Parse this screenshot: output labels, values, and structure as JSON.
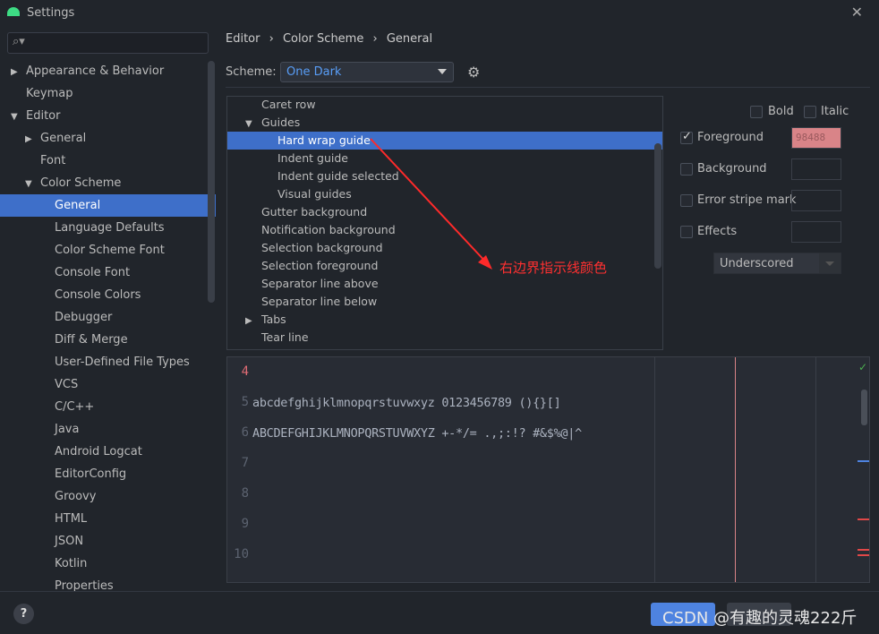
{
  "window": {
    "title": "Settings",
    "close": "✕"
  },
  "sidebar": {
    "search_icon": "⌕▾",
    "items": [
      {
        "label": "Appearance & Behavior",
        "arrow": "▶",
        "indent": 0
      },
      {
        "label": "Keymap",
        "arrow": "",
        "indent": 0
      },
      {
        "label": "Editor",
        "arrow": "▼",
        "indent": 0
      },
      {
        "label": "General",
        "arrow": "▶",
        "indent": 1
      },
      {
        "label": "Font",
        "arrow": "",
        "indent": 1
      },
      {
        "label": "Color Scheme",
        "arrow": "▼",
        "indent": 1
      },
      {
        "label": "General",
        "arrow": "",
        "indent": 2,
        "selected": true
      },
      {
        "label": "Language Defaults",
        "arrow": "",
        "indent": 2
      },
      {
        "label": "Color Scheme Font",
        "arrow": "",
        "indent": 2
      },
      {
        "label": "Console Font",
        "arrow": "",
        "indent": 2
      },
      {
        "label": "Console Colors",
        "arrow": "",
        "indent": 2
      },
      {
        "label": "Debugger",
        "arrow": "",
        "indent": 2
      },
      {
        "label": "Diff & Merge",
        "arrow": "",
        "indent": 2
      },
      {
        "label": "User-Defined File Types",
        "arrow": "",
        "indent": 2
      },
      {
        "label": "VCS",
        "arrow": "",
        "indent": 2
      },
      {
        "label": "C/C++",
        "arrow": "",
        "indent": 2
      },
      {
        "label": "Java",
        "arrow": "",
        "indent": 2
      },
      {
        "label": "Android Logcat",
        "arrow": "",
        "indent": 2
      },
      {
        "label": "EditorConfig",
        "arrow": "",
        "indent": 2
      },
      {
        "label": "Groovy",
        "arrow": "",
        "indent": 2
      },
      {
        "label": "HTML",
        "arrow": "",
        "indent": 2
      },
      {
        "label": "JSON",
        "arrow": "",
        "indent": 2
      },
      {
        "label": "Kotlin",
        "arrow": "",
        "indent": 2
      },
      {
        "label": "Properties",
        "arrow": "",
        "indent": 2
      }
    ]
  },
  "breadcrumb": [
    "Editor",
    "›",
    "Color Scheme",
    "›",
    "General"
  ],
  "scheme": {
    "label": "Scheme:",
    "value": "One Dark"
  },
  "tree": [
    {
      "label": "Caret row",
      "arrow": "",
      "indent": 1
    },
    {
      "label": "Guides",
      "arrow": "▼",
      "indent": 1
    },
    {
      "label": "Hard wrap guide",
      "arrow": "",
      "indent": 2,
      "selected": true
    },
    {
      "label": "Indent guide",
      "arrow": "",
      "indent": 2
    },
    {
      "label": "Indent guide selected",
      "arrow": "",
      "indent": 2
    },
    {
      "label": "Visual guides",
      "arrow": "",
      "indent": 2
    },
    {
      "label": "Gutter background",
      "arrow": "",
      "indent": 1
    },
    {
      "label": "Notification background",
      "arrow": "",
      "indent": 1
    },
    {
      "label": "Selection background",
      "arrow": "",
      "indent": 1
    },
    {
      "label": "Selection foreground",
      "arrow": "",
      "indent": 1
    },
    {
      "label": "Separator line above",
      "arrow": "",
      "indent": 1
    },
    {
      "label": "Separator line below",
      "arrow": "",
      "indent": 1
    },
    {
      "label": "Tabs",
      "arrow": "▶",
      "indent": 1
    },
    {
      "label": "Tear line",
      "arrow": "",
      "indent": 1
    }
  ],
  "props": {
    "bold": "Bold",
    "italic": "Italic",
    "foreground": "Foreground",
    "foreground_checked": true,
    "foreground_value": "98488",
    "foreground_color": "#d98488",
    "background": "Background",
    "error_stripe": "Error stripe mark",
    "effects": "Effects",
    "effect_type": "Underscored"
  },
  "editor": {
    "lines": [
      {
        "n": "4",
        "text": ""
      },
      {
        "n": "5",
        "text": "abcdefghijklmnopqrstuvwxyz 0123456789 (){}[]"
      },
      {
        "n": "6",
        "text": "ABCDEFGHIJKLMNOPQRSTUVWXYZ +-*/= .,;:!? #&$%@|^"
      },
      {
        "n": "7",
        "text": ""
      },
      {
        "n": "8",
        "text": ""
      },
      {
        "n": "9",
        "text": ""
      },
      {
        "n": "10",
        "text": ""
      }
    ],
    "wrap_guide_color": "#d98488"
  },
  "annotation": "右边界指示线颜色",
  "footer": {
    "help": "?",
    "watermark": "CSDN @有趣的灵魂222斤"
  }
}
